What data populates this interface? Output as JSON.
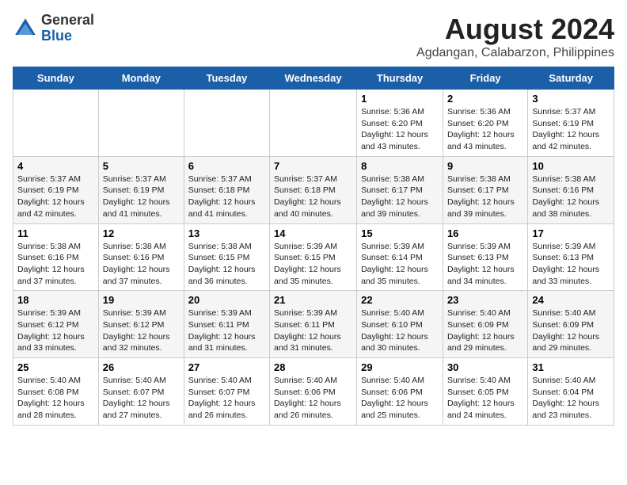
{
  "logo": {
    "text_general": "General",
    "text_blue": "Blue"
  },
  "header": {
    "title": "August 2024",
    "subtitle": "Agdangan, Calabarzon, Philippines"
  },
  "weekdays": [
    "Sunday",
    "Monday",
    "Tuesday",
    "Wednesday",
    "Thursday",
    "Friday",
    "Saturday"
  ],
  "weeks": [
    [
      {
        "num": "",
        "info": ""
      },
      {
        "num": "",
        "info": ""
      },
      {
        "num": "",
        "info": ""
      },
      {
        "num": "",
        "info": ""
      },
      {
        "num": "1",
        "info": "Sunrise: 5:36 AM\nSunset: 6:20 PM\nDaylight: 12 hours\nand 43 minutes."
      },
      {
        "num": "2",
        "info": "Sunrise: 5:36 AM\nSunset: 6:20 PM\nDaylight: 12 hours\nand 43 minutes."
      },
      {
        "num": "3",
        "info": "Sunrise: 5:37 AM\nSunset: 6:19 PM\nDaylight: 12 hours\nand 42 minutes."
      }
    ],
    [
      {
        "num": "4",
        "info": "Sunrise: 5:37 AM\nSunset: 6:19 PM\nDaylight: 12 hours\nand 42 minutes."
      },
      {
        "num": "5",
        "info": "Sunrise: 5:37 AM\nSunset: 6:19 PM\nDaylight: 12 hours\nand 41 minutes."
      },
      {
        "num": "6",
        "info": "Sunrise: 5:37 AM\nSunset: 6:18 PM\nDaylight: 12 hours\nand 41 minutes."
      },
      {
        "num": "7",
        "info": "Sunrise: 5:37 AM\nSunset: 6:18 PM\nDaylight: 12 hours\nand 40 minutes."
      },
      {
        "num": "8",
        "info": "Sunrise: 5:38 AM\nSunset: 6:17 PM\nDaylight: 12 hours\nand 39 minutes."
      },
      {
        "num": "9",
        "info": "Sunrise: 5:38 AM\nSunset: 6:17 PM\nDaylight: 12 hours\nand 39 minutes."
      },
      {
        "num": "10",
        "info": "Sunrise: 5:38 AM\nSunset: 6:16 PM\nDaylight: 12 hours\nand 38 minutes."
      }
    ],
    [
      {
        "num": "11",
        "info": "Sunrise: 5:38 AM\nSunset: 6:16 PM\nDaylight: 12 hours\nand 37 minutes."
      },
      {
        "num": "12",
        "info": "Sunrise: 5:38 AM\nSunset: 6:16 PM\nDaylight: 12 hours\nand 37 minutes."
      },
      {
        "num": "13",
        "info": "Sunrise: 5:38 AM\nSunset: 6:15 PM\nDaylight: 12 hours\nand 36 minutes."
      },
      {
        "num": "14",
        "info": "Sunrise: 5:39 AM\nSunset: 6:15 PM\nDaylight: 12 hours\nand 35 minutes."
      },
      {
        "num": "15",
        "info": "Sunrise: 5:39 AM\nSunset: 6:14 PM\nDaylight: 12 hours\nand 35 minutes."
      },
      {
        "num": "16",
        "info": "Sunrise: 5:39 AM\nSunset: 6:13 PM\nDaylight: 12 hours\nand 34 minutes."
      },
      {
        "num": "17",
        "info": "Sunrise: 5:39 AM\nSunset: 6:13 PM\nDaylight: 12 hours\nand 33 minutes."
      }
    ],
    [
      {
        "num": "18",
        "info": "Sunrise: 5:39 AM\nSunset: 6:12 PM\nDaylight: 12 hours\nand 33 minutes."
      },
      {
        "num": "19",
        "info": "Sunrise: 5:39 AM\nSunset: 6:12 PM\nDaylight: 12 hours\nand 32 minutes."
      },
      {
        "num": "20",
        "info": "Sunrise: 5:39 AM\nSunset: 6:11 PM\nDaylight: 12 hours\nand 31 minutes."
      },
      {
        "num": "21",
        "info": "Sunrise: 5:39 AM\nSunset: 6:11 PM\nDaylight: 12 hours\nand 31 minutes."
      },
      {
        "num": "22",
        "info": "Sunrise: 5:40 AM\nSunset: 6:10 PM\nDaylight: 12 hours\nand 30 minutes."
      },
      {
        "num": "23",
        "info": "Sunrise: 5:40 AM\nSunset: 6:09 PM\nDaylight: 12 hours\nand 29 minutes."
      },
      {
        "num": "24",
        "info": "Sunrise: 5:40 AM\nSunset: 6:09 PM\nDaylight: 12 hours\nand 29 minutes."
      }
    ],
    [
      {
        "num": "25",
        "info": "Sunrise: 5:40 AM\nSunset: 6:08 PM\nDaylight: 12 hours\nand 28 minutes."
      },
      {
        "num": "26",
        "info": "Sunrise: 5:40 AM\nSunset: 6:07 PM\nDaylight: 12 hours\nand 27 minutes."
      },
      {
        "num": "27",
        "info": "Sunrise: 5:40 AM\nSunset: 6:07 PM\nDaylight: 12 hours\nand 26 minutes."
      },
      {
        "num": "28",
        "info": "Sunrise: 5:40 AM\nSunset: 6:06 PM\nDaylight: 12 hours\nand 26 minutes."
      },
      {
        "num": "29",
        "info": "Sunrise: 5:40 AM\nSunset: 6:06 PM\nDaylight: 12 hours\nand 25 minutes."
      },
      {
        "num": "30",
        "info": "Sunrise: 5:40 AM\nSunset: 6:05 PM\nDaylight: 12 hours\nand 24 minutes."
      },
      {
        "num": "31",
        "info": "Sunrise: 5:40 AM\nSunset: 6:04 PM\nDaylight: 12 hours\nand 23 minutes."
      }
    ]
  ]
}
